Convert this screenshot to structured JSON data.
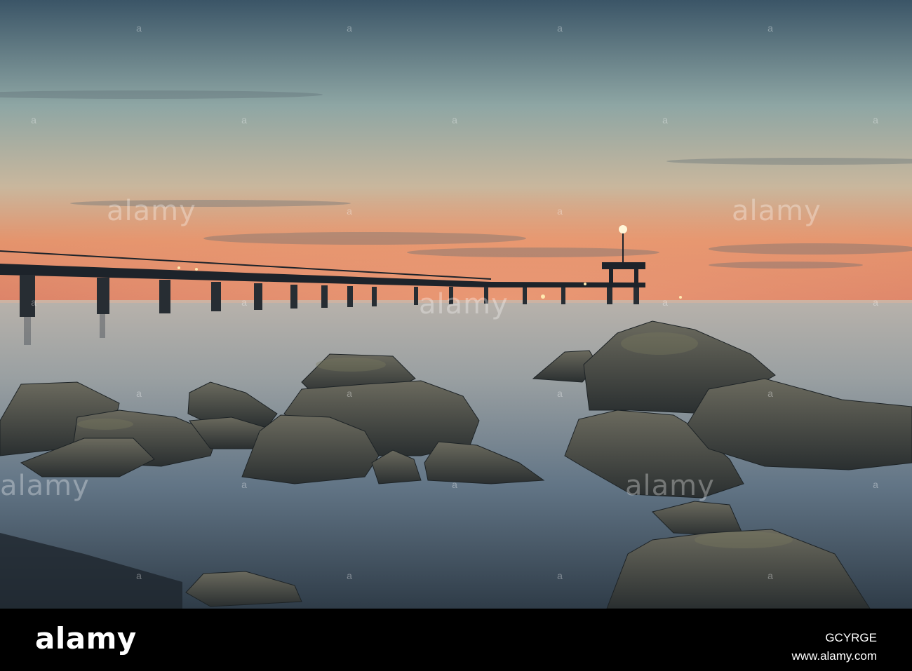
{
  "watermark": {
    "text": "alamy",
    "mark_glyph": "a"
  },
  "footer": {
    "logo": "alamy",
    "image_id": "GCYRGE",
    "url": "www.alamy.com"
  },
  "colors": {
    "sky_top": "#3a5266",
    "sky_mid": "#9fb0a8",
    "horizon_glow": "#e88a62",
    "sea": "#b9b8b2",
    "sea_dark": "#4d6172",
    "rock": "#3c3f3b",
    "footer_bg": "#000000"
  }
}
